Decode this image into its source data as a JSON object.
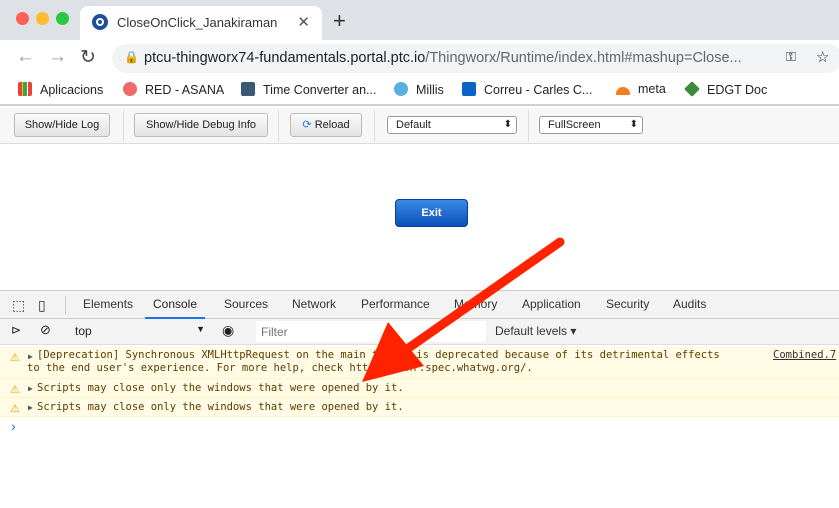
{
  "browser": {
    "tab_title": "CloseOnClick_Janakiraman",
    "url_host": "ptcu-thingworx74-fundamentals.portal.ptc.io",
    "url_path": "/Thingworx/Runtime/index.html#mashup=Close...",
    "bookmarks": [
      {
        "label": "Aplicacions",
        "color": "#4285f4"
      },
      {
        "label": "RED - ASANA",
        "color": "#f06a6a"
      },
      {
        "label": "Time Converter an...",
        "color": "#3b5875"
      },
      {
        "label": "Millis",
        "color": "#5aaee0"
      },
      {
        "label": "Correu - Carles C...",
        "color": "#0a64c8"
      },
      {
        "label": "meta",
        "color": "#f38020"
      },
      {
        "label": "EDGT Doc",
        "color": "#3c8a3c"
      }
    ]
  },
  "toolbar": {
    "show_hide_log": "Show/Hide Log",
    "show_hide_debug": "Show/Hide Debug Info",
    "reload": "Reload",
    "select1": "Default",
    "select2": "FullScreen"
  },
  "mashup": {
    "exit_label": "Exit"
  },
  "devtools": {
    "tabs": [
      "Elements",
      "Console",
      "Sources",
      "Network",
      "Performance",
      "Memory",
      "Application",
      "Security",
      "Audits"
    ],
    "active_tab": "Console",
    "context": "top",
    "filter_placeholder": "Filter",
    "levels": "Default levels ▾",
    "messages": [
      {
        "text": "[Deprecation] Synchronous XMLHttpRequest on the main thread is deprecated because of its detrimental effects\nto the end user's experience. For more help, check https://xhr.spec.whatwg.org/.",
        "source": "Combined.7"
      },
      {
        "text": "Scripts may close only the windows that were opened by it."
      },
      {
        "text": "Scripts may close only the windows that were opened by it."
      }
    ],
    "prompt": "›"
  },
  "annotation": {
    "arrow_color": "#ff2200"
  }
}
